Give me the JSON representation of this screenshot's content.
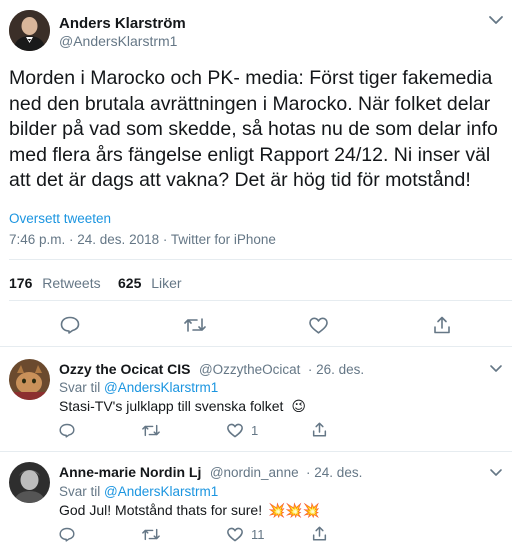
{
  "main_tweet": {
    "author_name": "Anders Klarström",
    "author_handle": "@AndersKlarstrm1",
    "text": "Morden i Marocko och PK- media: Först tiger fakemedia ned den brutala avrättningen i Marocko. När folket delar bilder på vad som skedde, så hotas nu de som delar info med flera års fängelse enligt Rapport 24/12. Ni inser väl att det är dags att vakna? Det är hög tid för motstånd!",
    "translate_link": "Oversett tweeten",
    "meta": "7:46 p.m. · 24. des. 2018 · Twitter for iPhone",
    "retweets_count": "176",
    "retweets_label": "Retweets",
    "likes_count": "625",
    "likes_label": "Liker"
  },
  "replies": [
    {
      "author_name": "Ozzy the Ocicat CIS",
      "author_handle": "@OzzytheOcicat",
      "date": "· 26. des.",
      "reply_prefix": "Svar til",
      "reply_to": "@AndersKlarstrm1",
      "text": "Stasi-TV's julklapp till svenska folket",
      "emoji": "😉",
      "likes": "1"
    },
    {
      "author_name": "Anne-marie Nordin Lj",
      "author_handle": "@nordin_anne",
      "date": "· 24. des.",
      "reply_prefix": "Svar til",
      "reply_to": "@AndersKlarstrm1",
      "text": "God Jul! Motstånd thats for sure!",
      "emoji": "💥💥💥",
      "likes": "11"
    }
  ],
  "colors": {
    "accent": "#1b95e0",
    "secondary": "#657786",
    "divider": "#e6ecf0"
  }
}
